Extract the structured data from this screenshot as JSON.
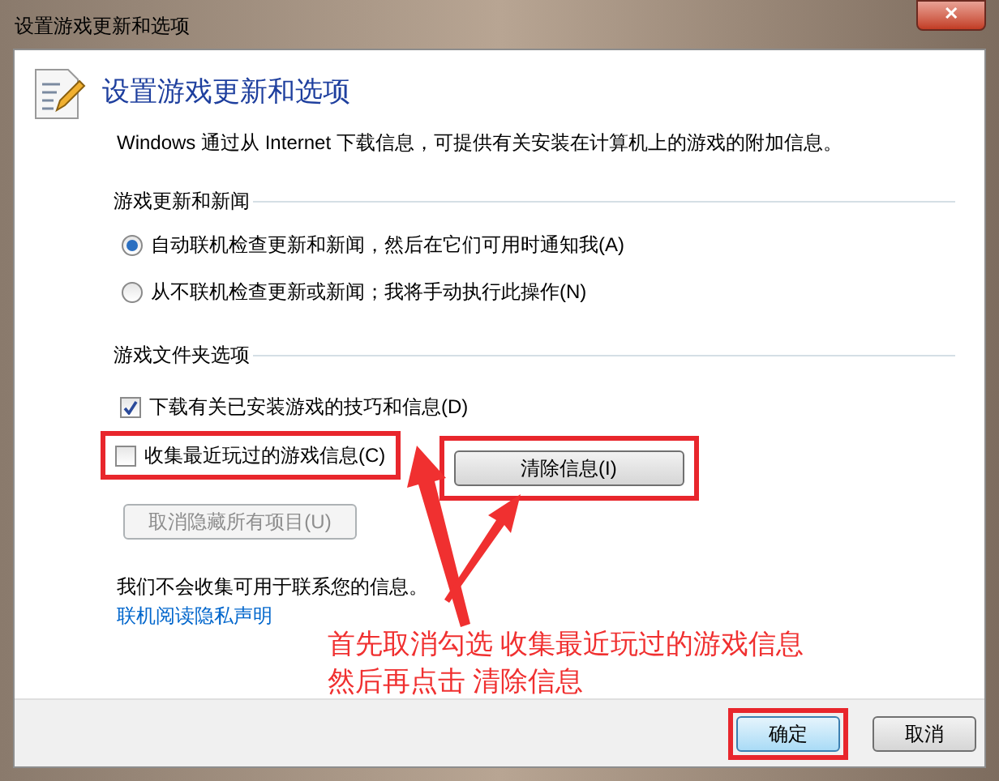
{
  "window": {
    "title": "设置游戏更新和选项",
    "close": "✕"
  },
  "header": {
    "title": "设置游戏更新和选项",
    "description": "Windows 通过从 Internet 下载信息，可提供有关安装在计算机上的游戏的附加信息。"
  },
  "news_section": {
    "heading": "游戏更新和新闻",
    "options": [
      {
        "label": "自动联机检查更新和新闻，然后在它们可用时通知我(A)",
        "selected": true
      },
      {
        "label": "从不联机检查更新或新闻；我将手动执行此操作(N)",
        "selected": false
      }
    ]
  },
  "folder_section": {
    "heading": "游戏文件夹选项",
    "options": [
      {
        "label": "下载有关已安装游戏的技巧和信息(D)",
        "checked": true,
        "highlighted": false
      },
      {
        "label": "收集最近玩过的游戏信息(C)",
        "checked": false,
        "highlighted": true
      }
    ],
    "clear_button": {
      "label": "清除信息(I)",
      "highlighted": true
    },
    "unhide_button": {
      "label": "取消隐藏所有项目(U)",
      "disabled": true
    }
  },
  "privacy": {
    "text": "我们不会收集可用于联系您的信息。",
    "link": "联机阅读隐私声明"
  },
  "annotation": {
    "lines": [
      "首先取消勾选 收集最近玩过的游戏信息",
      "然后再点击 清除信息"
    ]
  },
  "buttons": [
    {
      "label": "确定",
      "default": true,
      "highlighted": true
    },
    {
      "label": "取消",
      "default": false,
      "highlighted": false
    }
  ]
}
